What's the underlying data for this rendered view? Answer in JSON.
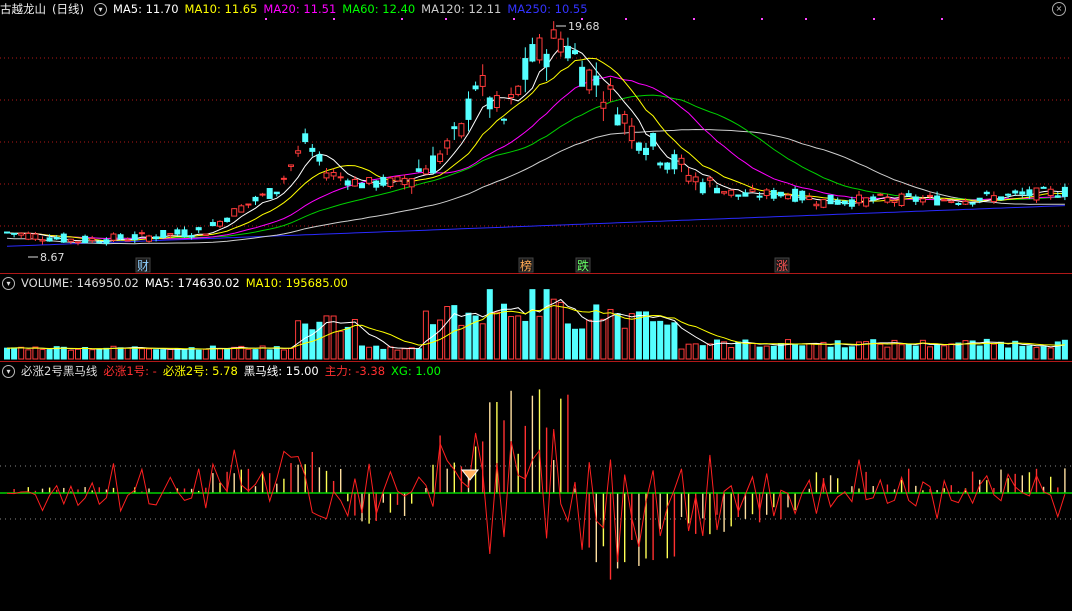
{
  "stock": {
    "name": "古越龙山",
    "period": "(日线)"
  },
  "main_legend": [
    {
      "label": "MA5: 11.70",
      "color": "#ffffff"
    },
    {
      "label": "MA10: 11.65",
      "color": "#ffff00"
    },
    {
      "label": "MA20: 11.51",
      "color": "#ff00ff"
    },
    {
      "label": "MA60: 12.40",
      "color": "#00ff00"
    },
    {
      "label": "MA120: 12.11",
      "color": "#cccccc"
    },
    {
      "label": "MA250: 10.55",
      "color": "#3333ff"
    }
  ],
  "price_annotations": {
    "high": "19.68",
    "low": "8.67"
  },
  "event_markers": [
    {
      "text": "财",
      "color": "#8fd0ff"
    },
    {
      "text": "榜",
      "color": "#ffaa55"
    },
    {
      "text": "跌",
      "color": "#66ff66"
    },
    {
      "text": "涨",
      "color": "#ff5555"
    }
  ],
  "volume_legend": [
    {
      "label": "VOLUME: 146950.02",
      "color": "#dddddd"
    },
    {
      "label": "MA5: 174630.02",
      "color": "#ffffff"
    },
    {
      "label": "MA10: 195685.00",
      "color": "#ffff00"
    }
  ],
  "indicator_legend": [
    {
      "label": "必涨2号黑马线",
      "color": "#dddddd"
    },
    {
      "label": "必涨1号: -",
      "color": "#ff3030"
    },
    {
      "label": "必涨2号: 5.78",
      "color": "#ffff00"
    },
    {
      "label": "黑马线: 15.00",
      "color": "#ffffff"
    },
    {
      "label": "主力: -3.38",
      "color": "#ff3030"
    },
    {
      "label": "XG: 1.00",
      "color": "#00ff00"
    }
  ],
  "colors": {
    "up": "#ff3b3b",
    "down": "#54ffff",
    "grid": "#b01818",
    "bg": "#000000"
  },
  "icons": [
    "chevron-down-icon",
    "close-icon"
  ]
}
